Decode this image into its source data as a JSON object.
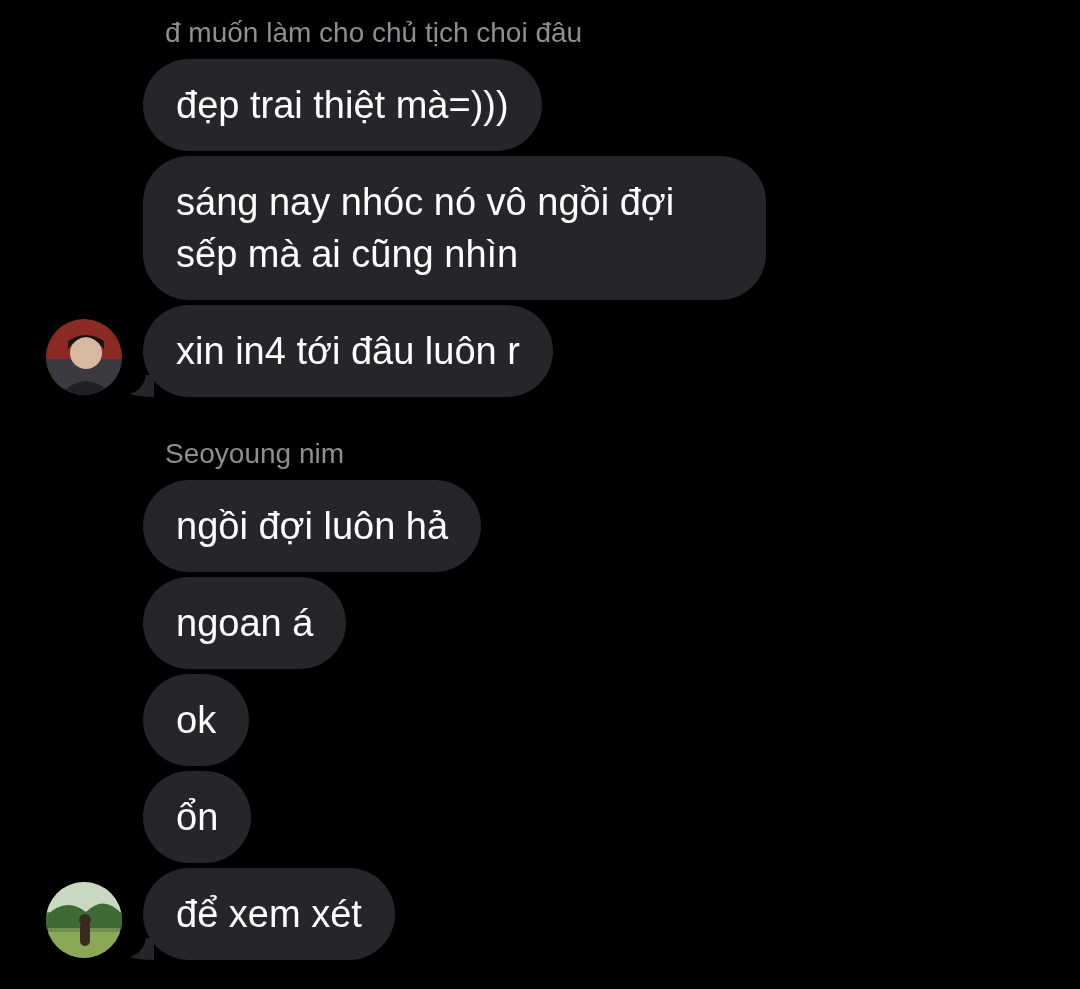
{
  "groups": [
    {
      "sender": "đ muốn làm cho chủ tịch choi đâu",
      "messages": [
        {
          "text": "đẹp trai thiệt mà=)))"
        },
        {
          "text": "sáng nay nhóc nó vô ngồi đợi sếp mà ai cũng nhìn"
        },
        {
          "text": "xin in4 tới đâu luôn r"
        }
      ]
    },
    {
      "sender": "Seoyoung nim",
      "messages": [
        {
          "text": "ngồi đợi luôn hả"
        },
        {
          "text": "ngoan á"
        },
        {
          "text": "ok"
        },
        {
          "text": "ổn"
        },
        {
          "text": "để xem xét"
        }
      ]
    }
  ]
}
